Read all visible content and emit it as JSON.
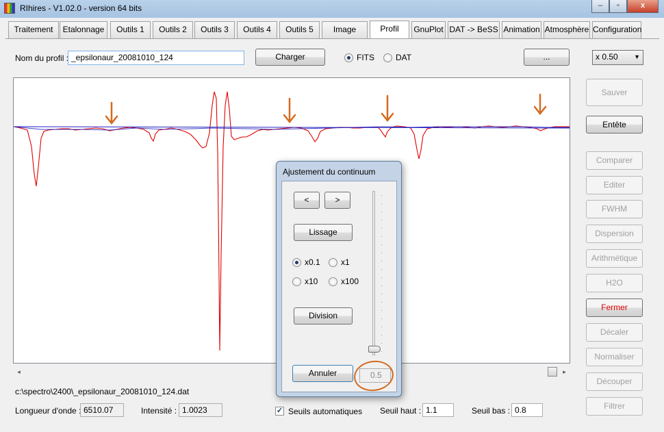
{
  "window": {
    "title": "RIhires - V1.02.0 - version 64 bits",
    "minimize_glyph": "–",
    "maximize_glyph": "▫",
    "close_glyph": "x"
  },
  "tabs": [
    {
      "label": "Traitement",
      "active": false
    },
    {
      "label": "Etalonnage",
      "active": false
    },
    {
      "label": "Outils 1",
      "active": false
    },
    {
      "label": "Outils 2",
      "active": false
    },
    {
      "label": "Outils 3",
      "active": false
    },
    {
      "label": "Outils 4",
      "active": false
    },
    {
      "label": "Outils 5",
      "active": false
    },
    {
      "label": "Image",
      "active": false
    },
    {
      "label": "Profil",
      "active": true
    },
    {
      "label": "GnuPlot",
      "active": false
    },
    {
      "label": "DAT -> BeSS",
      "active": false
    },
    {
      "label": "Animation",
      "active": false
    },
    {
      "label": "Atmosphère",
      "active": false
    },
    {
      "label": "Configuration",
      "active": false
    }
  ],
  "profile": {
    "name_label": "Nom du profil :",
    "name_value": "_epsilonaur_20081010_124",
    "load_button": "Charger",
    "format_fits": "FITS",
    "format_dat": "DAT",
    "format_selected": "FITS",
    "browse_button": "...",
    "zoom_value": "x 0.50",
    "zoom_arrow": "▼"
  },
  "side_buttons": [
    {
      "label": "Sauver",
      "enabled": false,
      "accent": false
    },
    {
      "label": "Entête",
      "enabled": true,
      "accent": false
    },
    {
      "label": "Comparer",
      "enabled": false,
      "accent": false
    },
    {
      "label": "Editer",
      "enabled": false,
      "accent": false
    },
    {
      "label": "FWHM",
      "enabled": false,
      "accent": false
    },
    {
      "label": "Dispersion",
      "enabled": false,
      "accent": false
    },
    {
      "label": "Arithmétique",
      "enabled": false,
      "accent": false
    },
    {
      "label": "H2O",
      "enabled": false,
      "accent": false
    },
    {
      "label": "Fermer",
      "enabled": true,
      "accent": true
    },
    {
      "label": "Décaler",
      "enabled": false,
      "accent": false
    },
    {
      "label": "Normaliser",
      "enabled": false,
      "accent": false
    },
    {
      "label": "Découper",
      "enabled": false,
      "accent": false
    },
    {
      "label": "Filtrer",
      "enabled": false,
      "accent": false
    }
  ],
  "scrollbar": {
    "left_arrow": "◂",
    "right_arrow": "▸"
  },
  "status": {
    "file_path": "c:\\spectro\\2400\\_epsilonaur_20081010_124.dat",
    "wavelength_label": "Longueur d'onde :",
    "wavelength_value": "6510.07",
    "intensity_label": "Intensité :",
    "intensity_value": "1.0023",
    "auto_threshold_label": "Seuils automatiques",
    "auto_threshold_checked": true,
    "check_glyph": "✓",
    "high_threshold_label": "Seuil haut :",
    "high_threshold_value": "1.1",
    "low_threshold_label": "Seuil bas :",
    "low_threshold_value": "0.8"
  },
  "dialog": {
    "title": "Ajustement du continuum",
    "prev_button": "<",
    "next_button": ">",
    "smooth_button": "Lissage",
    "step_options": [
      "x0.1",
      "x1",
      "x10",
      "x100"
    ],
    "step_selected": "x0.1",
    "division_button": "Division",
    "cancel_button": "Annuler",
    "slider_value": "0.5"
  },
  "colors": {
    "spectrum": "#e00000",
    "continuum": "#2020c0",
    "annotation": "#d56a1e",
    "accent_text": "#e00000"
  }
}
